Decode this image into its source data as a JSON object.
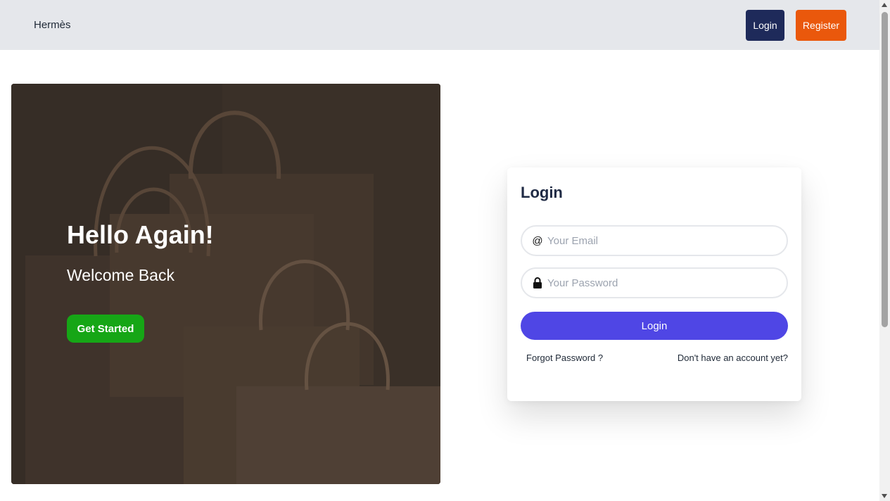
{
  "navbar": {
    "brand": "Hermès",
    "login_label": "Login",
    "register_label": "Register"
  },
  "hero": {
    "title": "Hello Again!",
    "subtitle": "Welcome Back",
    "cta_label": "Get Started"
  },
  "login_form": {
    "title": "Login",
    "email": {
      "icon": "at-icon",
      "placeholder": "Your Email",
      "value": ""
    },
    "password": {
      "icon": "lock-icon",
      "placeholder": "Your Password",
      "value": ""
    },
    "submit_label": "Login",
    "forgot_link": "Forgot Password ?",
    "signup_link": "Don't have an account yet?"
  },
  "colors": {
    "nav_login": "#1e2a5a",
    "nav_register": "#ea580c",
    "cta": "#16a616",
    "submit": "#4f46e5"
  }
}
